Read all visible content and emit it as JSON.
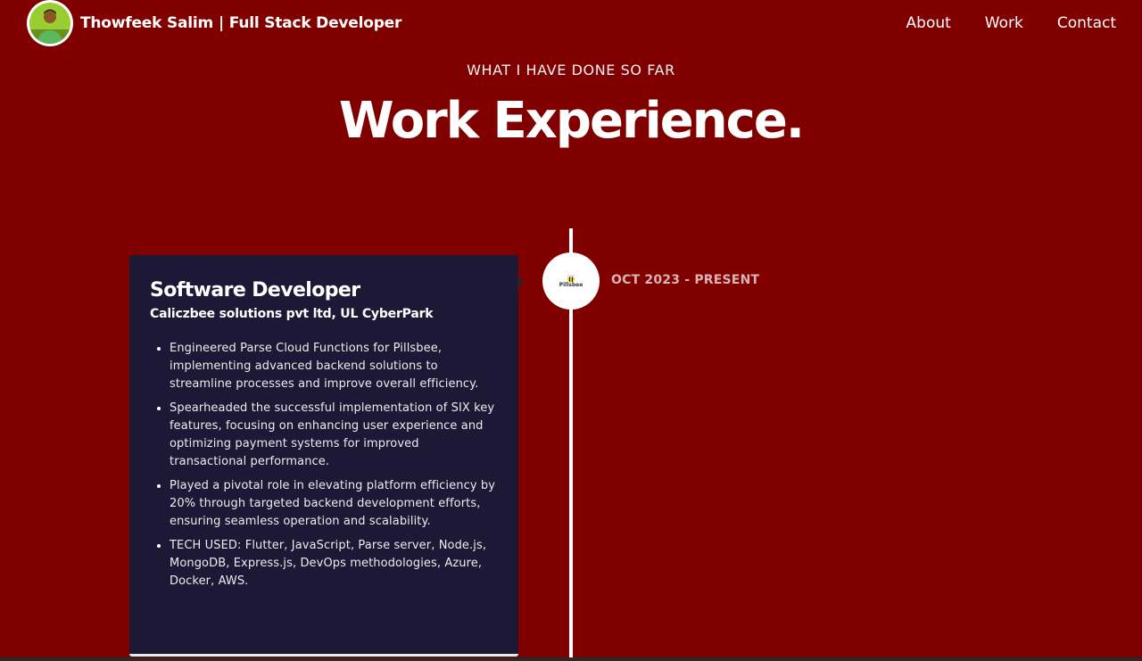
{
  "navbar": {
    "brand_name": "Thowfeek Salim",
    "brand_tagline": "| Full Stack Developer",
    "links": [
      {
        "label": "About"
      },
      {
        "label": "Work"
      },
      {
        "label": "Contact"
      }
    ]
  },
  "header": {
    "subtitle": "WHAT I HAVE DONE SO FAR",
    "title": "Work Experience."
  },
  "experiences": [
    {
      "role": "Software Developer",
      "company": "Caliczbee solutions pvt ltd, UL CyberPark",
      "date": "OCT 2023 - PRESENT",
      "logo_text": "Pillsbee",
      "points": [
        "Engineered Parse Cloud Functions for Pillsbee, implementing advanced backend solutions to streamline processes and improve overall efficiency.",
        "Spearheaded the successful implementation of SIX key features, focusing on enhancing user experience and optimizing payment systems for improved transactional performance.",
        "Played a pivotal role in elevating platform efficiency by 20% through targeted backend development efforts, ensuring seamless operation and scalability.",
        "TECH USED: Flutter, JavaScript, Parse server, Node.js, MongoDB, Express.js, DevOps methodologies, Azure, Docker, AWS."
      ]
    }
  ],
  "colors": {
    "page_background": "#800000",
    "card_background": "#1d1836",
    "timeline": "#ffffff",
    "date_text": "#d9b3b3"
  }
}
